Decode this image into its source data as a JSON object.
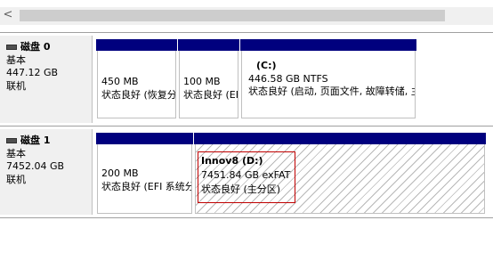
{
  "scrollbar": {
    "left_arrow": "<"
  },
  "disks": [
    {
      "title": "磁盘 0",
      "type": "基本",
      "size": "447.12 GB",
      "status": "联机",
      "partitions": [
        {
          "size": "450 MB",
          "status": "状态良好 (恢复分"
        },
        {
          "size": "100 MB",
          "status": "状态良好 (EFI"
        },
        {
          "name": "(C:)",
          "size": "446.58 GB NTFS",
          "status": "状态良好 (启动, 页面文件, 故障转储, 主分区)"
        }
      ]
    },
    {
      "title": "磁盘 1",
      "type": "基本",
      "size": "7452.04 GB",
      "status": "联机",
      "partitions": [
        {
          "size": "200 MB",
          "status": "状态良好 (EFI 系统分区)"
        },
        {
          "name": "Innov8  (D:)",
          "size": "7451.84 GB exFAT",
          "status": "状态良好 (主分区)"
        }
      ]
    }
  ]
}
